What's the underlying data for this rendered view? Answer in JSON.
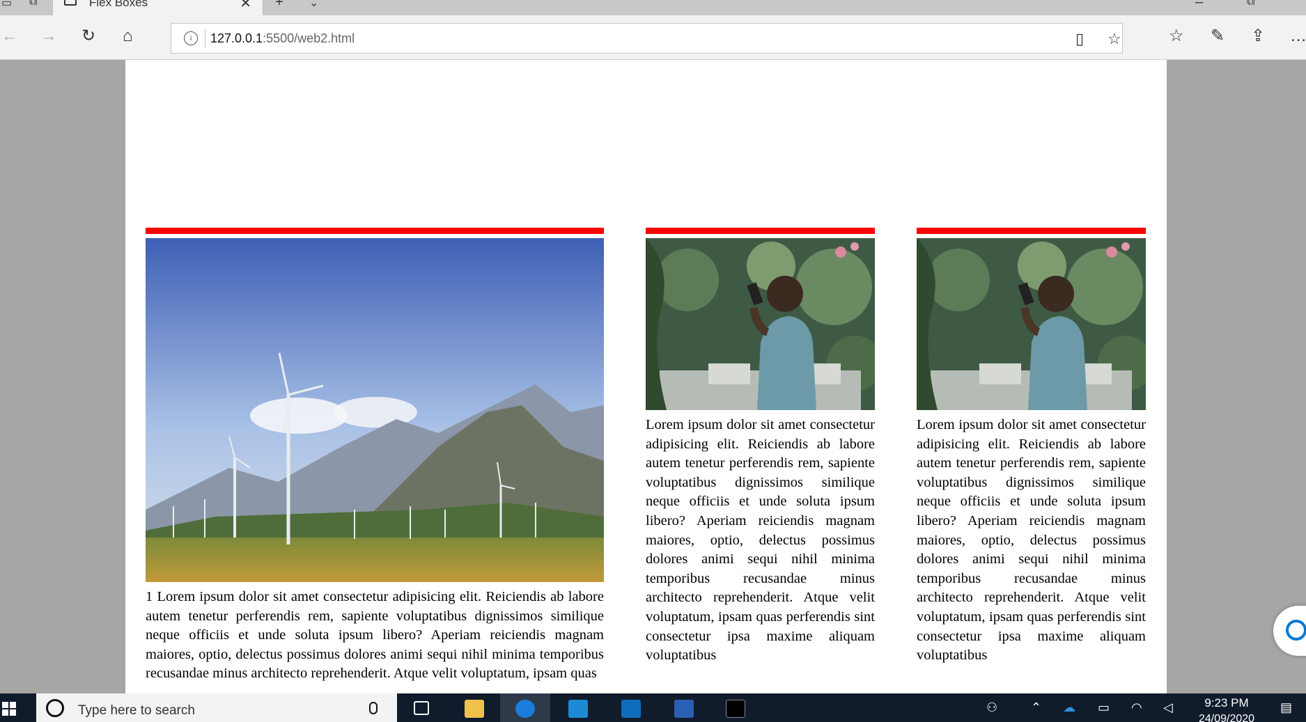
{
  "browser": {
    "tab_title": "Flex Boxes",
    "url_host": "127.0.0.1",
    "url_rest": ":5500/web2.html"
  },
  "cards": [
    {
      "text": "1 Lorem ipsum dolor sit amet consectetur adipisicing elit. Reiciendis ab labore autem tenetur perferendis rem, sapiente voluptatibus dignissimos similique neque officiis et unde soluta ipsum libero? Aperiam reiciendis magnam maiores, optio, delectus possimus dolores animi sequi nihil minima temporibus recusandae minus architecto reprehenderit. Atque velit voluptatum, ipsam quas"
    },
    {
      "text": "Lorem ipsum dolor sit amet consectetur adipisicing elit. Reiciendis ab labore autem tenetur perferendis rem, sapiente voluptatibus dignissimos similique neque officiis et unde soluta ipsum libero? Aperiam reiciendis magnam maiores, optio, delectus possimus dolores animi sequi nihil minima temporibus recusandae minus architecto reprehenderit. Atque velit voluptatum, ipsam quas perferendis sint consectetur ipsa maxime aliquam voluptatibus"
    },
    {
      "text": "Lorem ipsum dolor sit amet consectetur adipisicing elit. Reiciendis ab labore autem tenetur perferendis rem, sapiente voluptatibus dignissimos similique neque officiis et unde soluta ipsum libero? Aperiam reiciendis magnam maiores, optio, delectus possimus dolores animi sequi nihil minima temporibus recusandae minus architecto reprehenderit. Atque velit voluptatum, ipsam quas perferendis sint consectetur ipsa maxime aliquam voluptatibus"
    }
  ],
  "taskbar": {
    "search_placeholder": "Type here to search",
    "time": "9:23 PM",
    "date": "24/09/2020"
  },
  "colors": {
    "accent_bar": "#ff0000",
    "taskbar": "#101c2c"
  }
}
